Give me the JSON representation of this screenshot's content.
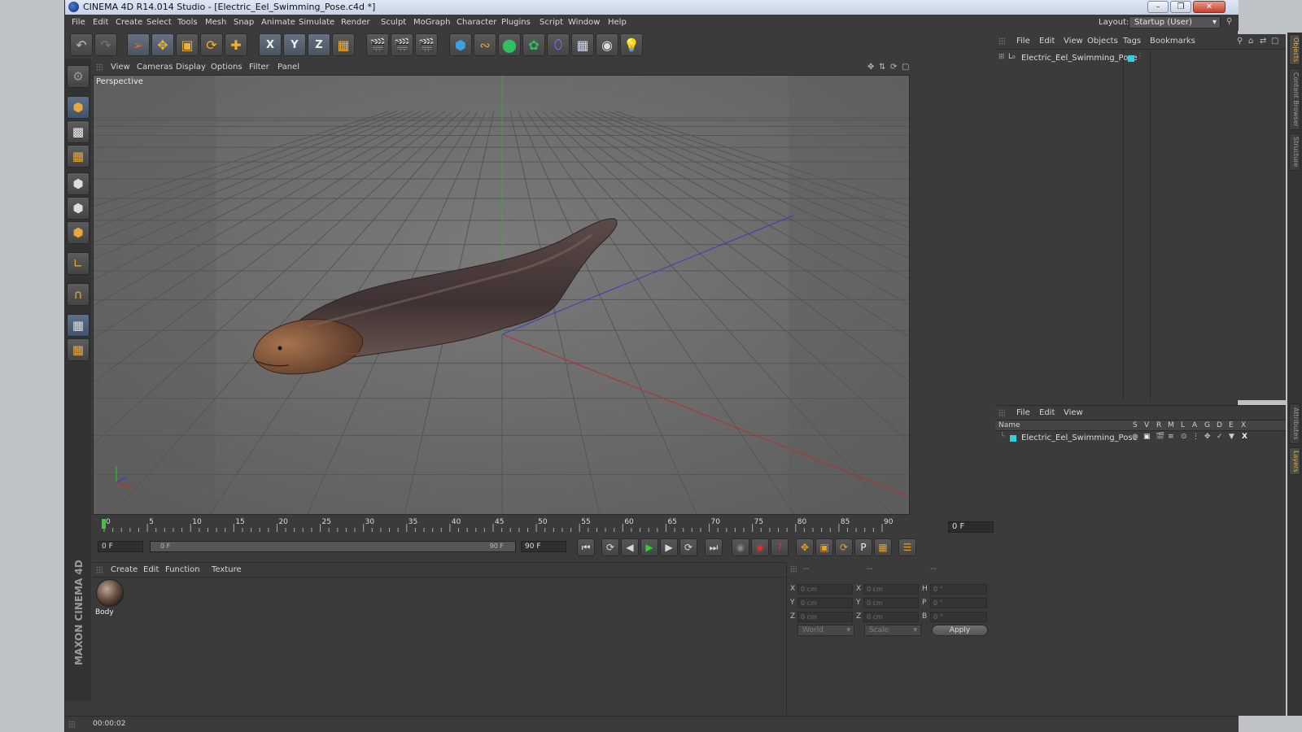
{
  "window": {
    "title": "CINEMA 4D R14.014 Studio - [Electric_Eel_Swimming_Pose.c4d *]",
    "minimize": "–",
    "maximize": "❐",
    "close": "✕"
  },
  "menu": [
    "File",
    "Edit",
    "Create",
    "Select",
    "Tools",
    "Mesh",
    "Snap",
    "Animate",
    "Simulate",
    "Render",
    "Sculpt",
    "MoGraph",
    "Character",
    "Plugins",
    "Script",
    "Window",
    "Help"
  ],
  "layout": {
    "label": "Layout:",
    "value": "Startup (User)"
  },
  "toolbar": {
    "icons": [
      "undo-icon",
      "redo-icon",
      "live-selection-icon",
      "move-icon",
      "scale-icon",
      "rotate-icon",
      "last-tool-icon",
      "x-axis-icon",
      "y-axis-icon",
      "z-axis-icon",
      "coordinate-system-icon",
      "render-view-icon",
      "render-to-picture-viewer-icon",
      "render-settings-icon",
      "cube-primitive-icon",
      "spline-icon",
      "nurbs-icon",
      "mograph-cloner-icon",
      "deformer-icon",
      "floor-environment-icon",
      "camera-icon",
      "light-icon"
    ],
    "axis_x": "X",
    "axis_y": "Y",
    "axis_z": "Z"
  },
  "left_tools": [
    "make-editable-icon",
    "model-mode-icon",
    "texture-mode-icon",
    "workplane-mode-icon",
    "points-mode-icon",
    "edges-mode-icon",
    "polygons-mode-icon",
    "axis-mode-icon",
    "magnet-icon",
    "snap-grid-icon",
    "snap-settings-icon"
  ],
  "brand": "MAXON CINEMA 4D",
  "viewport": {
    "menu": [
      "View",
      "Cameras",
      "Display",
      "Options",
      "Filter",
      "Panel"
    ],
    "label": "Perspective"
  },
  "timeline": {
    "ticks": [
      "0",
      "5",
      "10",
      "15",
      "20",
      "25",
      "30",
      "35",
      "40",
      "45",
      "50",
      "55",
      "60",
      "65",
      "70",
      "75",
      "80",
      "85",
      "90"
    ],
    "current_frame": "0 F",
    "start_field": "0 F",
    "range_start": "0 F",
    "range_end": "90 F",
    "end_field": "90 F"
  },
  "material_manager": {
    "menu": [
      "Create",
      "Edit",
      "Function",
      "Texture"
    ],
    "materials": [
      {
        "name": "Body"
      }
    ]
  },
  "coordinates": {
    "header": [
      "--",
      "--",
      "--"
    ],
    "rows": [
      {
        "l1": "X",
        "v1": "0 cm",
        "l2": "X",
        "v2": "0 cm",
        "l3": "H",
        "v3": "0 °"
      },
      {
        "l1": "Y",
        "v1": "0 cm",
        "l2": "Y",
        "v2": "0 cm",
        "l3": "P",
        "v3": "0 °"
      },
      {
        "l1": "Z",
        "v1": "0 cm",
        "l2": "Z",
        "v2": "0 cm",
        "l3": "B",
        "v3": "0 °"
      }
    ],
    "world": "World",
    "scale": "Scale",
    "apply": "Apply"
  },
  "object_manager": {
    "menu": [
      "File",
      "Edit",
      "View",
      "Objects",
      "Tags",
      "Bookmarks"
    ],
    "objects": [
      {
        "name": "Electric_Eel_Swimming_Pose",
        "color": "#2fd0e4"
      }
    ]
  },
  "layer_manager": {
    "menu": [
      "File",
      "Edit",
      "View"
    ],
    "columns": [
      "Name",
      "S",
      "V",
      "R",
      "M",
      "L",
      "A",
      "G",
      "D",
      "E",
      "X"
    ],
    "layers": [
      {
        "name": "Electric_Eel_Swimming_Pose",
        "color": "#2fd0e4"
      }
    ]
  },
  "side_tabs": [
    "Objects",
    "Content Browser",
    "Structure",
    "Attributes",
    "Layers"
  ],
  "status": {
    "time": "00:00:02"
  },
  "colors": {
    "accent": "#f0b030",
    "x_axis": "#c03030",
    "y_axis": "#30b030",
    "z_axis": "#3040c0",
    "play": "#33cc33"
  }
}
